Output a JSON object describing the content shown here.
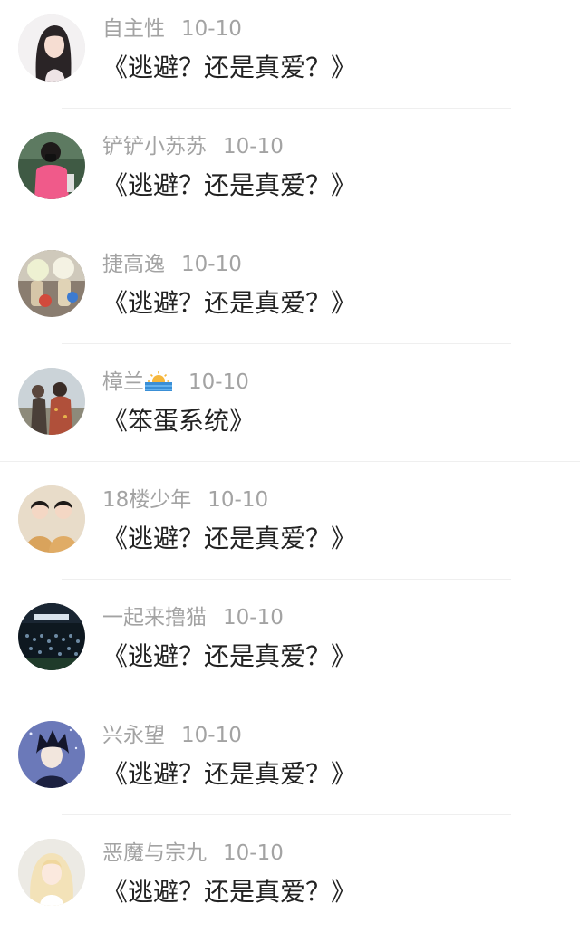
{
  "comments": [
    {
      "username": "自主性",
      "date": "10-10",
      "text": "《逃避？还是真爱？》",
      "avatar": "avatar-girl-dark-hair"
    },
    {
      "username": "铲铲小苏苏",
      "date": "10-10",
      "text": "《逃避？还是真爱？》",
      "avatar": "avatar-person-pink-shirt"
    },
    {
      "username": "捷高逸",
      "date": "10-10",
      "text": "《逃避？还是真爱？》",
      "avatar": "avatar-decorated-bottles"
    },
    {
      "username": "樟兰",
      "date": "10-10",
      "text": "《笨蛋系统》",
      "avatar": "avatar-people-outdoor",
      "emoji": "sunrise-emoji"
    },
    {
      "username": "18楼少年",
      "date": "10-10",
      "text": "《逃避？还是真爱？》",
      "avatar": "avatar-two-boys"
    },
    {
      "username": "一起来撸猫",
      "date": "10-10",
      "text": "《逃避？还是真爱？》",
      "avatar": "avatar-concert-stage"
    },
    {
      "username": "兴永望",
      "date": "10-10",
      "text": "《逃避？还是真爱？》",
      "avatar": "avatar-anime-boy"
    },
    {
      "username": "恶魔与宗九",
      "date": "10-10",
      "text": "《逃避？还是真爱？》",
      "avatar": "avatar-anime-girl-blonde"
    }
  ]
}
